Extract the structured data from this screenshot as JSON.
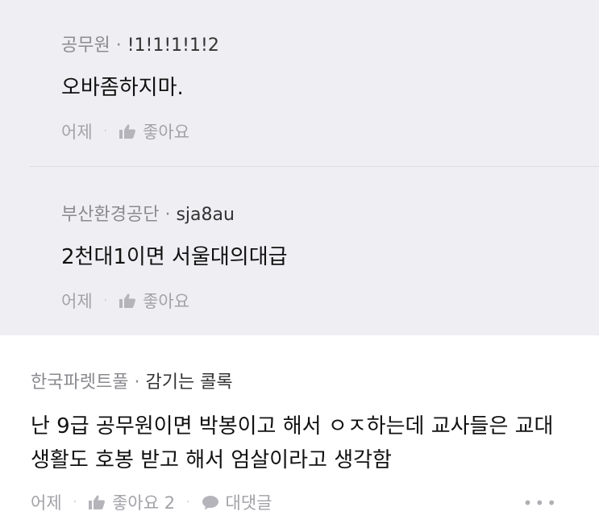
{
  "replies": [
    {
      "affiliation": "공무원",
      "separator": "·",
      "nickname": "!1!1!1!1!2",
      "text": "오바좀하지마.",
      "time": "어제",
      "like_label": "좋아요"
    },
    {
      "affiliation": "부산환경공단",
      "separator": "·",
      "nickname": "sja8au",
      "text": "2천대1이면 서울대의대급",
      "time": "어제",
      "like_label": "좋아요"
    }
  ],
  "comment": {
    "affiliation": "한국파렛트풀",
    "separator": "·",
    "nickname": "감기는 콜록",
    "text_line1": "난 9급 공무원이면 박봉이고 해서 ㅇㅈ하는데 교사들은 교대",
    "text_line2": "생활도 호봉 받고 해서 엄살이라고 생각함",
    "time": "어제",
    "like_label": "좋아요 2",
    "reply_label": "대댓글",
    "more": "•••"
  },
  "colors": {
    "reply_bg": "#efeff3",
    "comment_bg": "#ffffff",
    "muted": "#a2a2a8",
    "text": "#111111"
  },
  "icons": [
    "thumbs-up-icon",
    "speech-bubble-icon",
    "more-icon"
  ]
}
